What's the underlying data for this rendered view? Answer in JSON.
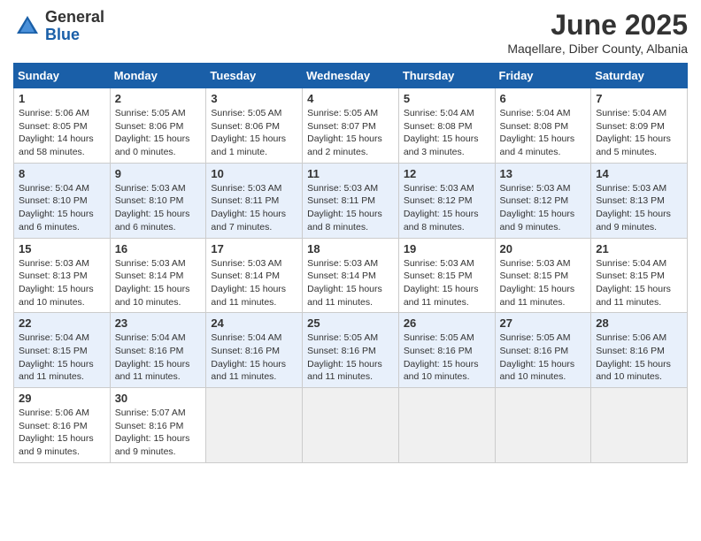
{
  "logo": {
    "general": "General",
    "blue": "Blue"
  },
  "title": "June 2025",
  "location": "Maqellare, Diber County, Albania",
  "days_header": [
    "Sunday",
    "Monday",
    "Tuesday",
    "Wednesday",
    "Thursday",
    "Friday",
    "Saturday"
  ],
  "weeks": [
    [
      {
        "day": "1",
        "info": "Sunrise: 5:06 AM\nSunset: 8:05 PM\nDaylight: 14 hours\nand 58 minutes."
      },
      {
        "day": "2",
        "info": "Sunrise: 5:05 AM\nSunset: 8:06 PM\nDaylight: 15 hours\nand 0 minutes."
      },
      {
        "day": "3",
        "info": "Sunrise: 5:05 AM\nSunset: 8:06 PM\nDaylight: 15 hours\nand 1 minute."
      },
      {
        "day": "4",
        "info": "Sunrise: 5:05 AM\nSunset: 8:07 PM\nDaylight: 15 hours\nand 2 minutes."
      },
      {
        "day": "5",
        "info": "Sunrise: 5:04 AM\nSunset: 8:08 PM\nDaylight: 15 hours\nand 3 minutes."
      },
      {
        "day": "6",
        "info": "Sunrise: 5:04 AM\nSunset: 8:08 PM\nDaylight: 15 hours\nand 4 minutes."
      },
      {
        "day": "7",
        "info": "Sunrise: 5:04 AM\nSunset: 8:09 PM\nDaylight: 15 hours\nand 5 minutes."
      }
    ],
    [
      {
        "day": "8",
        "info": "Sunrise: 5:04 AM\nSunset: 8:10 PM\nDaylight: 15 hours\nand 6 minutes."
      },
      {
        "day": "9",
        "info": "Sunrise: 5:03 AM\nSunset: 8:10 PM\nDaylight: 15 hours\nand 6 minutes."
      },
      {
        "day": "10",
        "info": "Sunrise: 5:03 AM\nSunset: 8:11 PM\nDaylight: 15 hours\nand 7 minutes."
      },
      {
        "day": "11",
        "info": "Sunrise: 5:03 AM\nSunset: 8:11 PM\nDaylight: 15 hours\nand 8 minutes."
      },
      {
        "day": "12",
        "info": "Sunrise: 5:03 AM\nSunset: 8:12 PM\nDaylight: 15 hours\nand 8 minutes."
      },
      {
        "day": "13",
        "info": "Sunrise: 5:03 AM\nSunset: 8:12 PM\nDaylight: 15 hours\nand 9 minutes."
      },
      {
        "day": "14",
        "info": "Sunrise: 5:03 AM\nSunset: 8:13 PM\nDaylight: 15 hours\nand 9 minutes."
      }
    ],
    [
      {
        "day": "15",
        "info": "Sunrise: 5:03 AM\nSunset: 8:13 PM\nDaylight: 15 hours\nand 10 minutes."
      },
      {
        "day": "16",
        "info": "Sunrise: 5:03 AM\nSunset: 8:14 PM\nDaylight: 15 hours\nand 10 minutes."
      },
      {
        "day": "17",
        "info": "Sunrise: 5:03 AM\nSunset: 8:14 PM\nDaylight: 15 hours\nand 11 minutes."
      },
      {
        "day": "18",
        "info": "Sunrise: 5:03 AM\nSunset: 8:14 PM\nDaylight: 15 hours\nand 11 minutes."
      },
      {
        "day": "19",
        "info": "Sunrise: 5:03 AM\nSunset: 8:15 PM\nDaylight: 15 hours\nand 11 minutes."
      },
      {
        "day": "20",
        "info": "Sunrise: 5:03 AM\nSunset: 8:15 PM\nDaylight: 15 hours\nand 11 minutes."
      },
      {
        "day": "21",
        "info": "Sunrise: 5:04 AM\nSunset: 8:15 PM\nDaylight: 15 hours\nand 11 minutes."
      }
    ],
    [
      {
        "day": "22",
        "info": "Sunrise: 5:04 AM\nSunset: 8:15 PM\nDaylight: 15 hours\nand 11 minutes."
      },
      {
        "day": "23",
        "info": "Sunrise: 5:04 AM\nSunset: 8:16 PM\nDaylight: 15 hours\nand 11 minutes."
      },
      {
        "day": "24",
        "info": "Sunrise: 5:04 AM\nSunset: 8:16 PM\nDaylight: 15 hours\nand 11 minutes."
      },
      {
        "day": "25",
        "info": "Sunrise: 5:05 AM\nSunset: 8:16 PM\nDaylight: 15 hours\nand 11 minutes."
      },
      {
        "day": "26",
        "info": "Sunrise: 5:05 AM\nSunset: 8:16 PM\nDaylight: 15 hours\nand 10 minutes."
      },
      {
        "day": "27",
        "info": "Sunrise: 5:05 AM\nSunset: 8:16 PM\nDaylight: 15 hours\nand 10 minutes."
      },
      {
        "day": "28",
        "info": "Sunrise: 5:06 AM\nSunset: 8:16 PM\nDaylight: 15 hours\nand 10 minutes."
      }
    ],
    [
      {
        "day": "29",
        "info": "Sunrise: 5:06 AM\nSunset: 8:16 PM\nDaylight: 15 hours\nand 9 minutes."
      },
      {
        "day": "30",
        "info": "Sunrise: 5:07 AM\nSunset: 8:16 PM\nDaylight: 15 hours\nand 9 minutes."
      },
      {
        "day": "",
        "info": ""
      },
      {
        "day": "",
        "info": ""
      },
      {
        "day": "",
        "info": ""
      },
      {
        "day": "",
        "info": ""
      },
      {
        "day": "",
        "info": ""
      }
    ]
  ]
}
